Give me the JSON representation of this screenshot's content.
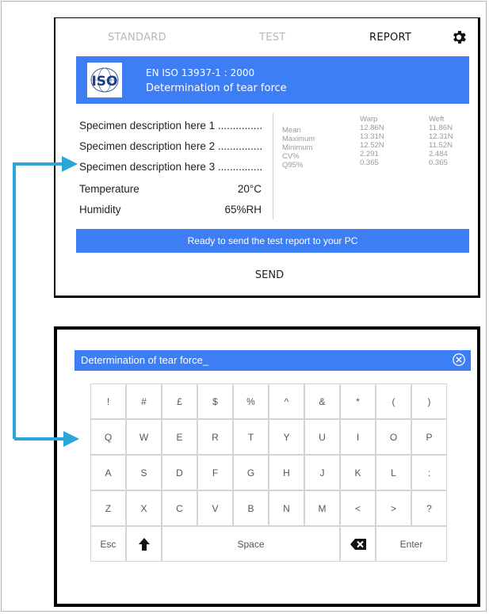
{
  "top_screen": {
    "tabs": [
      {
        "label": "STANDARD",
        "active": false
      },
      {
        "label": "TEST",
        "active": false
      },
      {
        "label": "REPORT",
        "active": true
      }
    ],
    "settings_icon": "gear-icon",
    "standard": {
      "logo_text": "ISO",
      "code": "EN ISO 13937-1 : 2000",
      "name": "Determination of tear force"
    },
    "specimens": [
      "Specimen description here 1 ...............",
      "Specimen description here 2 ...............",
      "Specimen description here 3 ..............."
    ],
    "environment": [
      {
        "label": "Temperature",
        "value": "20°C"
      },
      {
        "label": "Humidity",
        "value": "65%RH"
      }
    ],
    "stats": {
      "columns": [
        "Warp",
        "Weft"
      ],
      "rows": [
        {
          "label": "Mean",
          "warp": "12.86N",
          "weft": "11.86N"
        },
        {
          "label": "Maximum",
          "warp": "13.31N",
          "weft": "12.31N"
        },
        {
          "label": "Minimum",
          "warp": "12.52N",
          "weft": "11.52N"
        },
        {
          "label": "CV%",
          "warp": "2.291",
          "weft": "2.484"
        },
        {
          "label": "Q95%",
          "warp": "0.365",
          "weft": "0.365"
        }
      ]
    },
    "status_message": "Ready to send the test report to your PC",
    "send_label": "SEND"
  },
  "bottom_screen": {
    "input_value": "Determination of tear force_",
    "close_icon": "close-circle-icon",
    "keyboard": {
      "rows": [
        [
          "!",
          "#",
          "£",
          "$",
          "%",
          "^",
          "&",
          "*",
          "(",
          ")"
        ],
        [
          "Q",
          "W",
          "E",
          "R",
          "T",
          "Y",
          "U",
          "I",
          "O",
          "P"
        ],
        [
          "A",
          "S",
          "D",
          "F",
          "G",
          "H",
          "J",
          "K",
          "L",
          ":"
        ],
        [
          "Z",
          "X",
          "C",
          "V",
          "B",
          "N",
          "M",
          "<",
          ">",
          "?"
        ]
      ],
      "esc_label": "Esc",
      "shift_icon": "shift-arrow-icon",
      "space_label": "Space",
      "backspace_icon": "backspace-icon",
      "enter_label": "Enter"
    }
  },
  "colors": {
    "accent_blue": "#3d7ef4",
    "arrow_blue": "#2aa6d8"
  }
}
